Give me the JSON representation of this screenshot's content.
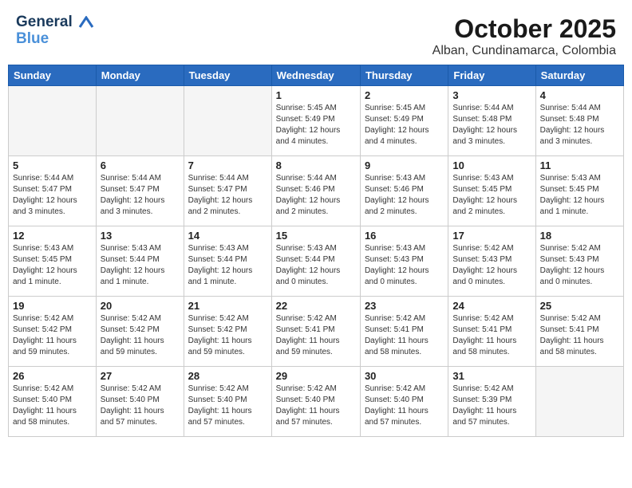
{
  "logo": {
    "line1": "General",
    "line2": "Blue"
  },
  "title": "October 2025",
  "location": "Alban, Cundinamarca, Colombia",
  "weekdays": [
    "Sunday",
    "Monday",
    "Tuesday",
    "Wednesday",
    "Thursday",
    "Friday",
    "Saturday"
  ],
  "weeks": [
    [
      {
        "day": "",
        "info": ""
      },
      {
        "day": "",
        "info": ""
      },
      {
        "day": "",
        "info": ""
      },
      {
        "day": "1",
        "info": "Sunrise: 5:45 AM\nSunset: 5:49 PM\nDaylight: 12 hours\nand 4 minutes."
      },
      {
        "day": "2",
        "info": "Sunrise: 5:45 AM\nSunset: 5:49 PM\nDaylight: 12 hours\nand 4 minutes."
      },
      {
        "day": "3",
        "info": "Sunrise: 5:44 AM\nSunset: 5:48 PM\nDaylight: 12 hours\nand 3 minutes."
      },
      {
        "day": "4",
        "info": "Sunrise: 5:44 AM\nSunset: 5:48 PM\nDaylight: 12 hours\nand 3 minutes."
      }
    ],
    [
      {
        "day": "5",
        "info": "Sunrise: 5:44 AM\nSunset: 5:47 PM\nDaylight: 12 hours\nand 3 minutes."
      },
      {
        "day": "6",
        "info": "Sunrise: 5:44 AM\nSunset: 5:47 PM\nDaylight: 12 hours\nand 3 minutes."
      },
      {
        "day": "7",
        "info": "Sunrise: 5:44 AM\nSunset: 5:47 PM\nDaylight: 12 hours\nand 2 minutes."
      },
      {
        "day": "8",
        "info": "Sunrise: 5:44 AM\nSunset: 5:46 PM\nDaylight: 12 hours\nand 2 minutes."
      },
      {
        "day": "9",
        "info": "Sunrise: 5:43 AM\nSunset: 5:46 PM\nDaylight: 12 hours\nand 2 minutes."
      },
      {
        "day": "10",
        "info": "Sunrise: 5:43 AM\nSunset: 5:45 PM\nDaylight: 12 hours\nand 2 minutes."
      },
      {
        "day": "11",
        "info": "Sunrise: 5:43 AM\nSunset: 5:45 PM\nDaylight: 12 hours\nand 1 minute."
      }
    ],
    [
      {
        "day": "12",
        "info": "Sunrise: 5:43 AM\nSunset: 5:45 PM\nDaylight: 12 hours\nand 1 minute."
      },
      {
        "day": "13",
        "info": "Sunrise: 5:43 AM\nSunset: 5:44 PM\nDaylight: 12 hours\nand 1 minute."
      },
      {
        "day": "14",
        "info": "Sunrise: 5:43 AM\nSunset: 5:44 PM\nDaylight: 12 hours\nand 1 minute."
      },
      {
        "day": "15",
        "info": "Sunrise: 5:43 AM\nSunset: 5:44 PM\nDaylight: 12 hours\nand 0 minutes."
      },
      {
        "day": "16",
        "info": "Sunrise: 5:43 AM\nSunset: 5:43 PM\nDaylight: 12 hours\nand 0 minutes."
      },
      {
        "day": "17",
        "info": "Sunrise: 5:42 AM\nSunset: 5:43 PM\nDaylight: 12 hours\nand 0 minutes."
      },
      {
        "day": "18",
        "info": "Sunrise: 5:42 AM\nSunset: 5:43 PM\nDaylight: 12 hours\nand 0 minutes."
      }
    ],
    [
      {
        "day": "19",
        "info": "Sunrise: 5:42 AM\nSunset: 5:42 PM\nDaylight: 11 hours\nand 59 minutes."
      },
      {
        "day": "20",
        "info": "Sunrise: 5:42 AM\nSunset: 5:42 PM\nDaylight: 11 hours\nand 59 minutes."
      },
      {
        "day": "21",
        "info": "Sunrise: 5:42 AM\nSunset: 5:42 PM\nDaylight: 11 hours\nand 59 minutes."
      },
      {
        "day": "22",
        "info": "Sunrise: 5:42 AM\nSunset: 5:41 PM\nDaylight: 11 hours\nand 59 minutes."
      },
      {
        "day": "23",
        "info": "Sunrise: 5:42 AM\nSunset: 5:41 PM\nDaylight: 11 hours\nand 58 minutes."
      },
      {
        "day": "24",
        "info": "Sunrise: 5:42 AM\nSunset: 5:41 PM\nDaylight: 11 hours\nand 58 minutes."
      },
      {
        "day": "25",
        "info": "Sunrise: 5:42 AM\nSunset: 5:41 PM\nDaylight: 11 hours\nand 58 minutes."
      }
    ],
    [
      {
        "day": "26",
        "info": "Sunrise: 5:42 AM\nSunset: 5:40 PM\nDaylight: 11 hours\nand 58 minutes."
      },
      {
        "day": "27",
        "info": "Sunrise: 5:42 AM\nSunset: 5:40 PM\nDaylight: 11 hours\nand 57 minutes."
      },
      {
        "day": "28",
        "info": "Sunrise: 5:42 AM\nSunset: 5:40 PM\nDaylight: 11 hours\nand 57 minutes."
      },
      {
        "day": "29",
        "info": "Sunrise: 5:42 AM\nSunset: 5:40 PM\nDaylight: 11 hours\nand 57 minutes."
      },
      {
        "day": "30",
        "info": "Sunrise: 5:42 AM\nSunset: 5:40 PM\nDaylight: 11 hours\nand 57 minutes."
      },
      {
        "day": "31",
        "info": "Sunrise: 5:42 AM\nSunset: 5:39 PM\nDaylight: 11 hours\nand 57 minutes."
      },
      {
        "day": "",
        "info": ""
      }
    ]
  ]
}
